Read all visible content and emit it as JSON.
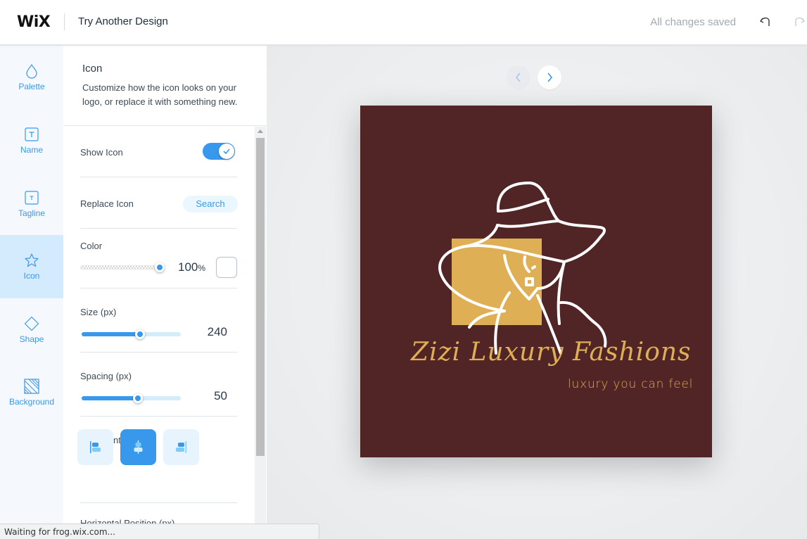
{
  "header": {
    "brand": "WiX",
    "title": "Try Another Design",
    "save_status": "All changes saved",
    "undo_icon": "undo-icon",
    "redo_icon": "redo-icon"
  },
  "rail": {
    "items": [
      {
        "label": "Palette",
        "icon": "droplet-icon",
        "active": false
      },
      {
        "label": "Name",
        "icon": "text-box-icon",
        "active": false
      },
      {
        "label": "Tagline",
        "icon": "small-text-box-icon",
        "active": false
      },
      {
        "label": "Icon",
        "icon": "star-icon",
        "active": true
      },
      {
        "label": "Shape",
        "icon": "diamond-icon",
        "active": false
      },
      {
        "label": "Background",
        "icon": "striped-square-icon",
        "active": false
      }
    ]
  },
  "panel": {
    "title": "Icon",
    "description": "Customize how the icon looks on your logo, or replace it with something new.",
    "show_icon": {
      "label": "Show Icon",
      "enabled": true
    },
    "replace_icon": {
      "label": "Replace Icon",
      "button": "Search"
    },
    "color": {
      "label": "Color",
      "opacity_value": "100",
      "opacity_unit": "%",
      "swatch": "#ffffff"
    },
    "size": {
      "label": "Size (px)",
      "value": "240",
      "fraction": 0.59
    },
    "spacing": {
      "label": "Spacing (px)",
      "value": "50",
      "fraction": 0.57
    },
    "alignment": {
      "label": "Alignment",
      "options": [
        "left",
        "center",
        "right"
      ],
      "selected": "center"
    },
    "next_section_label": "Horizontal Position (px)"
  },
  "canvas": {
    "logo": {
      "name": "Zizi Luxury Fashions",
      "tagline": "luxury you can feel",
      "background_color": "#512425",
      "accent_color": "#deaf55",
      "icon_line_color": "#ffffff"
    }
  },
  "status_bar": {
    "text": "Waiting for frog.wix.com..."
  }
}
